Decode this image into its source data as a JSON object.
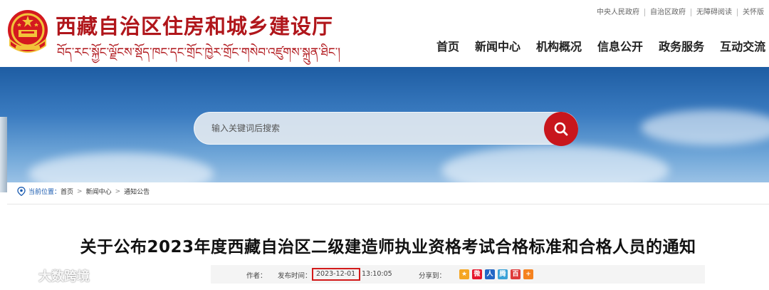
{
  "header": {
    "site_title": "西藏自治区住房和城乡建设厅",
    "site_subtitle_tibetan": "བོད་རང་སྐྱོང་ལྗོངས་སྡོད་ཁང་དང་གྲོང་ཁྱེར་གྲོང་གསེབ་འཛུགས་སྐྲུན་ཐིང་།",
    "top_links": [
      "中央人民政府",
      "自治区政府",
      "无障碍阅读",
      "关怀版"
    ],
    "nav": [
      "首页",
      "新闻中心",
      "机构概况",
      "信息公开",
      "政务服务",
      "互动交流"
    ]
  },
  "search": {
    "placeholder": "输入关键词后搜索",
    "icon": "search-icon"
  },
  "breadcrumb": {
    "label": "当前位置：",
    "items": [
      "首页",
      "新闻中心",
      "通知公告"
    ],
    "separator": ">"
  },
  "article": {
    "title": "关于公布2023年度西藏自治区二级建造师执业资格考试合格标准和合格人员的通知",
    "author_label": "作者：",
    "publish_label": "发布时间：",
    "publish_date": "2023-12-01",
    "publish_time": "13:10:05",
    "share_label": "分享到："
  },
  "share_icons": [
    "qzone-icon",
    "weibo-icon",
    "renren-icon",
    "tencent-weibo-icon",
    "baidu-icon",
    "more-share-icon"
  ],
  "watermark": {
    "text": "大数跨境"
  },
  "colors": {
    "brand_red": "#b0161b",
    "search_button": "#c8161d",
    "highlight_box": "#d31a1a",
    "breadcrumb_label": "#1a5bb0"
  }
}
